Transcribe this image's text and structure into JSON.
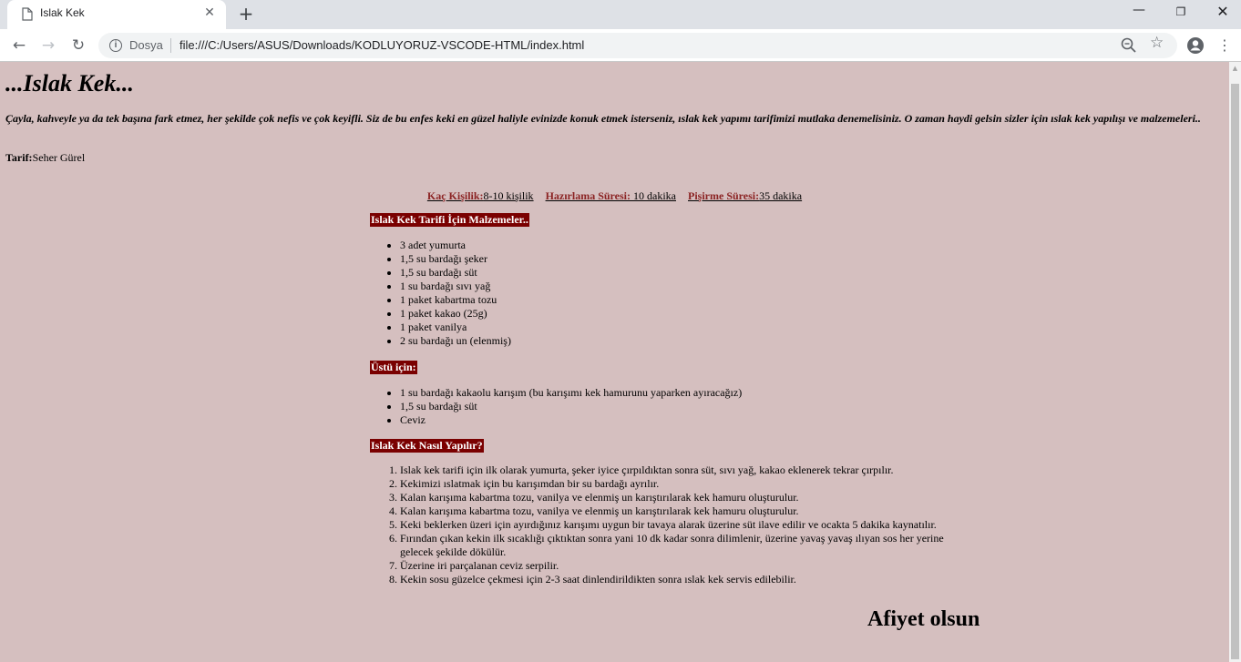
{
  "browser": {
    "tab_title": "Islak Kek",
    "new_tab_symbol": "+",
    "scheme_label": "Dosya",
    "url": "file:///C:/Users/ASUS/Downloads/KODLUYORUZ-VSCODE-HTML/index.html",
    "icons": [
      "page-icon",
      "close-icon",
      "new-tab-icon",
      "minimize-icon",
      "restore-icon",
      "window-close-icon",
      "back-icon",
      "forward-icon",
      "reload-icon",
      "info-icon",
      "zoom-icon",
      "star-icon",
      "account-icon",
      "menu-icon"
    ]
  },
  "page": {
    "title": "...Islak Kek...",
    "intro": "Çayla, kahveyle ya da tek başına fark etmez, her şekilde çok nefis ve çok keyifli. Siz de bu enfes keki en güzel haliyle evinizde konuk etmek isterseniz, ıslak kek yapımı tarifimizi mutlaka denemelisiniz. O zaman haydi gelsin sizler için ıslak kek yapılışı ve malzemeleri..",
    "author_label": "Tarif:",
    "author_name": "Seher Gürel",
    "meta": {
      "servings_label": "Kaç Kişilik:",
      "servings_value": "8-10 kişilik",
      "prep_label": "Hazırlama Süresi:",
      "prep_value": " 10 dakika",
      "cook_label": "Pişirme Süresi:",
      "cook_value": "35 dakika"
    },
    "ingredients_heading": "Islak Kek Tarifi İçin Malzemeler..",
    "ingredients": [
      "3 adet yumurta",
      "1,5 su bardağı şeker",
      "1,5 su bardağı süt",
      "1 su bardağı sıvı yağ",
      "1 paket kabartma tozu",
      "1 paket kakao (25g)",
      "1 paket vanilya",
      "2 su bardağı un (elenmiş)"
    ],
    "topping_heading": "Üstü için:",
    "topping": [
      "1 su bardağı kakaolu karışım (bu karışımı kek hamurunu yaparken ayıracağız)",
      "1,5 su bardağı süt",
      "Ceviz"
    ],
    "method_heading": "Islak Kek Nasıl Yapılır?",
    "method": [
      "Islak kek tarifi için ilk olarak yumurta, şeker iyice çırpıldıktan sonra süt, sıvı yağ, kakao eklenerek tekrar çırpılır.",
      "Kekimizi ıslatmak için bu karışımdan bir su bardağı ayrılır.",
      "Kalan karışıma kabartma tozu, vanilya ve elenmiş un karıştırılarak kek hamuru oluşturulur.",
      "Kalan karışıma kabartma tozu, vanilya ve elenmiş un karıştırılarak kek hamuru oluşturulur.",
      "Keki beklerken üzeri için ayırdığınız karışımı uygun bir tavaya alarak üzerine süt ilave edilir ve ocakta 5 dakika kaynatılır.",
      "Fırından çıkan kekin ilk sıcaklığı çıktıktan sonra yani 10 dk kadar sonra dilimlenir, üzerine yavaş yavaş ılıyan sos her yerine gelecek şekilde dökülür.",
      "Üzerine iri parçalanan ceviz serpilir.",
      "Kekin sosu güzelce çekmesi için 2-3 saat dinlendirildikten sonra ıslak kek servis edilebilir."
    ],
    "closing": "Afiyet olsun"
  },
  "colors": {
    "page_background": "#d5bfbf",
    "heading_background": "#7a0000",
    "meta_label": "#8b2323"
  }
}
